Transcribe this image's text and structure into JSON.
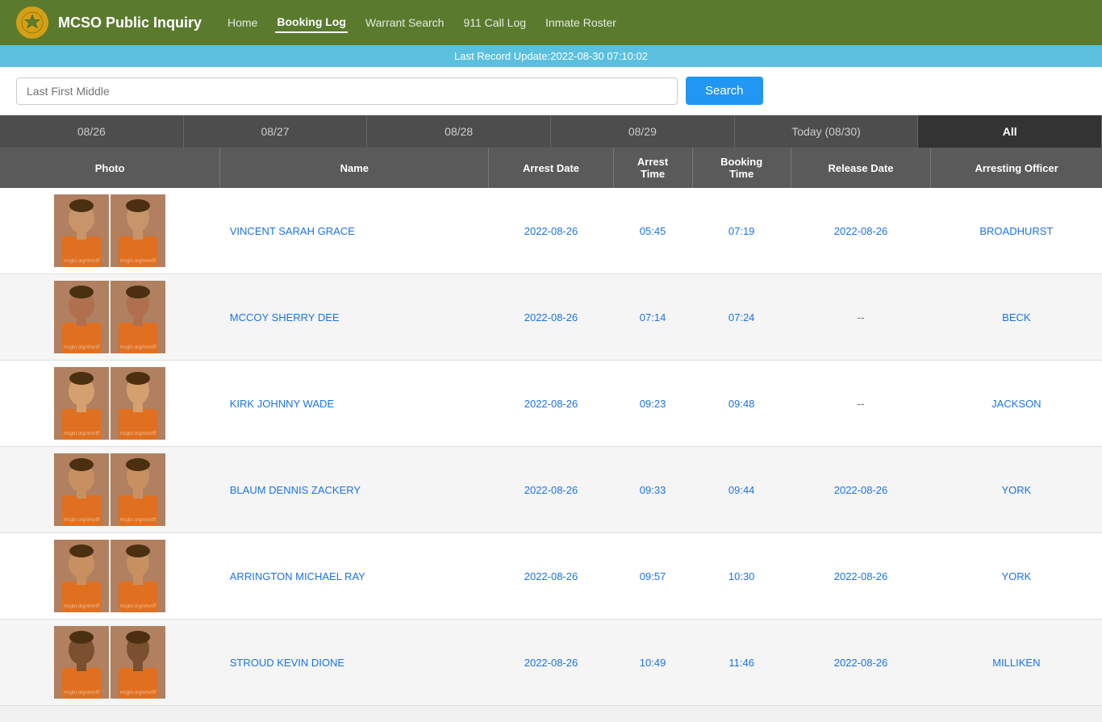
{
  "app": {
    "title": "MCSO Public Inquiry",
    "logo_emoji": "⭐"
  },
  "navbar": {
    "home_label": "Home",
    "booking_log_label": "Booking Log",
    "warrant_search_label": "Warrant Search",
    "call_log_label": "911 Call Log",
    "inmate_roster_label": "Inmate Roster",
    "active": "Booking Log"
  },
  "update_banner": {
    "text": "Last Record Update:2022-08-30 07:10:02"
  },
  "search": {
    "placeholder": "Last First Middle",
    "button_label": "Search"
  },
  "date_tabs": [
    {
      "label": "08/26"
    },
    {
      "label": "08/27"
    },
    {
      "label": "08/28"
    },
    {
      "label": "08/29"
    },
    {
      "label": "Today (08/30)"
    },
    {
      "label": "All",
      "active": true
    }
  ],
  "table_headers": [
    "Photo",
    "Name",
    "Arrest Date",
    "Arrest Time",
    "Booking Time",
    "Release Date",
    "Arresting Officer"
  ],
  "records": [
    {
      "id": 1,
      "name": "VINCENT SARAH GRACE",
      "arrest_date": "2022-08-26",
      "arrest_time": "05:45",
      "booking_time": "07:19",
      "release_date": "2022-08-26",
      "officer": "BROADHURST",
      "photo_skin": "#c8956a"
    },
    {
      "id": 2,
      "name": "MCCOY SHERRY DEE",
      "arrest_date": "2022-08-26",
      "arrest_time": "07:14",
      "booking_time": "07:24",
      "release_date": "--",
      "officer": "BECK",
      "photo_skin": "#b07050"
    },
    {
      "id": 3,
      "name": "KIRK JOHNNY WADE",
      "arrest_date": "2022-08-26",
      "arrest_time": "09:23",
      "booking_time": "09:48",
      "release_date": "--",
      "officer": "JACKSON",
      "photo_skin": "#d4a070"
    },
    {
      "id": 4,
      "name": "BLAUM DENNIS ZACKERY",
      "arrest_date": "2022-08-26",
      "arrest_time": "09:33",
      "booking_time": "09:44",
      "release_date": "2022-08-26",
      "officer": "YORK",
      "photo_skin": "#c89060"
    },
    {
      "id": 5,
      "name": "ARRINGTON MICHAEL RAY",
      "arrest_date": "2022-08-26",
      "arrest_time": "09:57",
      "booking_time": "10:30",
      "release_date": "2022-08-26",
      "officer": "YORK",
      "photo_skin": "#c89060"
    },
    {
      "id": 6,
      "name": "STROUD KEVIN DIONE",
      "arrest_date": "2022-08-26",
      "arrest_time": "10:49",
      "booking_time": "11:46",
      "release_date": "2022-08-26",
      "officer": "MILLIKEN",
      "photo_skin": "#7a5030"
    }
  ]
}
